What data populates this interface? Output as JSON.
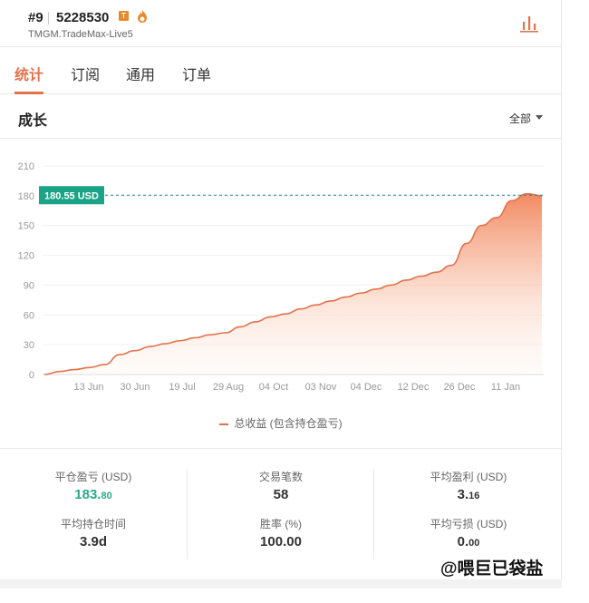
{
  "header": {
    "rank": "#9",
    "account_id": "5228530",
    "badge": "T",
    "server": "TMGM.TradeMax-Live5"
  },
  "tabs": [
    {
      "label": "统计",
      "active": true
    },
    {
      "label": "订阅",
      "active": false
    },
    {
      "label": "通用",
      "active": false
    },
    {
      "label": "订单",
      "active": false
    }
  ],
  "section": {
    "title": "成长",
    "filter_label": "全部"
  },
  "chart_data": {
    "type": "area",
    "y_ticks": [
      "0",
      "30",
      "60",
      "90",
      "120",
      "150",
      "180",
      "210"
    ],
    "ylim": [
      0,
      210
    ],
    "x_ticks": [
      "13 Jun",
      "30 Jun",
      "19 Jul",
      "29 Aug",
      "04 Oct",
      "03 Nov",
      "04 Dec",
      "12 Dec",
      "26 Dec",
      "11 Jan"
    ],
    "reference_line": {
      "value": 180.55,
      "label": "180.55 USD"
    },
    "series": [
      {
        "name": "总收益 (包含持仓盈亏)",
        "color": "#e2734b",
        "values": [
          0,
          3,
          5,
          7,
          10,
          20,
          24,
          28,
          31,
          34,
          37,
          40,
          42,
          48,
          53,
          58,
          61,
          66,
          70,
          74,
          78,
          82,
          86,
          90,
          95,
          99,
          103,
          110,
          132,
          150,
          158,
          175,
          182,
          180
        ]
      }
    ],
    "grid": true
  },
  "stats": [
    {
      "label": "平仓盈亏 (USD)",
      "value_main": "183.",
      "value_small": "80",
      "color": "#2aa88a"
    },
    {
      "label": "交易笔数",
      "value_main": "58",
      "value_small": ""
    },
    {
      "label": "平均盈利 (USD)",
      "value_main": "3.",
      "value_small": "16"
    },
    {
      "label": "平均持仓时间",
      "value_main": "3.9d",
      "value_small": ""
    },
    {
      "label": "胜率 (%)",
      "value_main": "100.00",
      "value_small": ""
    },
    {
      "label": "平均亏损 (USD)",
      "value_main": "0.",
      "value_small": "00"
    }
  ],
  "watermark": "@喂巨已袋盐"
}
